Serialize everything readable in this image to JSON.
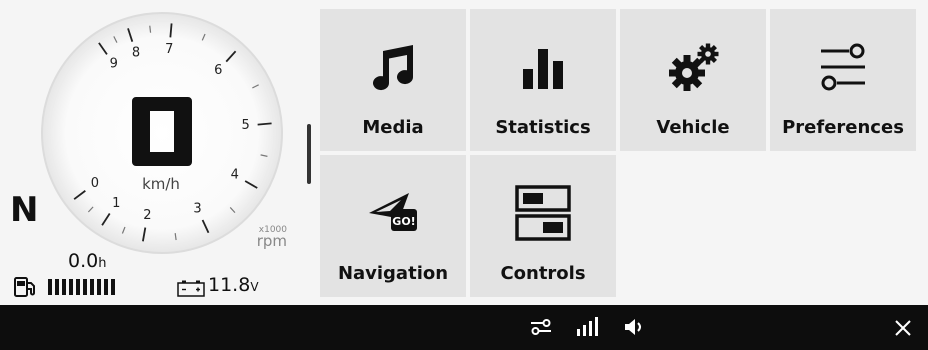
{
  "gauge": {
    "speed_value": "0",
    "speed_unit": "km/h",
    "rpm_multiplier": "x1000",
    "rpm_unit": "rpm",
    "rpm_scale_labels": [
      "0",
      "1",
      "2",
      "3",
      "4",
      "5",
      "6",
      "7",
      "8",
      "9"
    ],
    "gear": "N",
    "trip_value": "0.0",
    "trip_unit": "h",
    "fuel_segments": 10,
    "battery_value": "11.8",
    "battery_unit": "V"
  },
  "menu": {
    "items": [
      {
        "label": "Media",
        "icon": "music-note-icon"
      },
      {
        "label": "Statistics",
        "icon": "bar-chart-icon"
      },
      {
        "label": "Vehicle",
        "icon": "gears-icon"
      },
      {
        "label": "Preferences",
        "icon": "sliders-icon"
      },
      {
        "label": "Navigation",
        "icon": "navigation-go-icon",
        "badge": "GO!"
      },
      {
        "label": "Controls",
        "icon": "toggles-icon"
      }
    ]
  },
  "bottom_bar": {
    "icons": [
      "sliders-icon",
      "signal-icon",
      "volume-icon",
      "close-icon"
    ]
  },
  "colors": {
    "background": "#f5f5f5",
    "tile": "#e3e3e3",
    "bar": "#0d0d0d",
    "text": "#111111"
  }
}
